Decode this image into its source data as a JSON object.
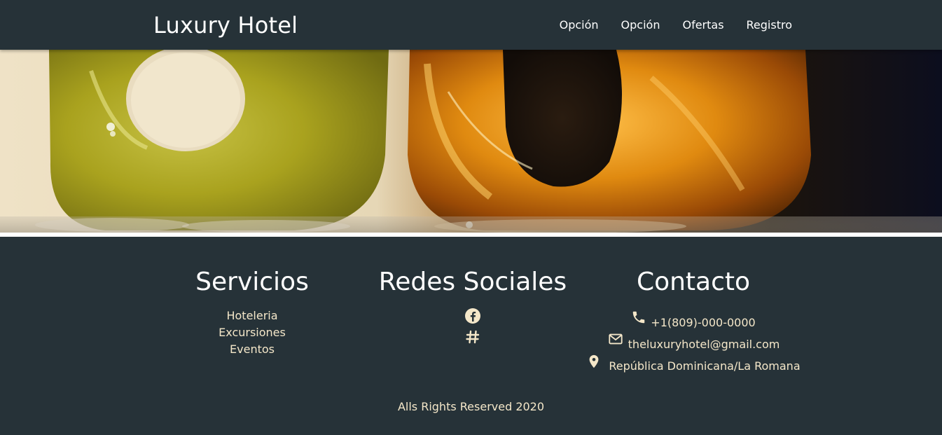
{
  "navbar": {
    "brand": "Luxury Hotel",
    "links": [
      "Opción",
      "Opción",
      "Ofertas",
      "Registro"
    ]
  },
  "banner": {
    "image": "glass-sculptures-photo"
  },
  "footer": {
    "services": {
      "title": "Servicios",
      "items": [
        "Hoteleria",
        "Excursiones",
        "Eventos"
      ]
    },
    "social": {
      "title": "Redes Sociales",
      "icons": [
        "facebook-icon",
        "hashtag-icon"
      ]
    },
    "contact": {
      "title": "Contacto",
      "phone": "+1(809)-000-0000",
      "email": "theluxuryhotel@gmail.com",
      "location": "República Dominicana/La Romana"
    },
    "copyright": "Alls Rights Reserved 2020"
  },
  "colors": {
    "dark": "#263238",
    "accent_text": "#f4e7c9",
    "white": "#ffffff"
  }
}
